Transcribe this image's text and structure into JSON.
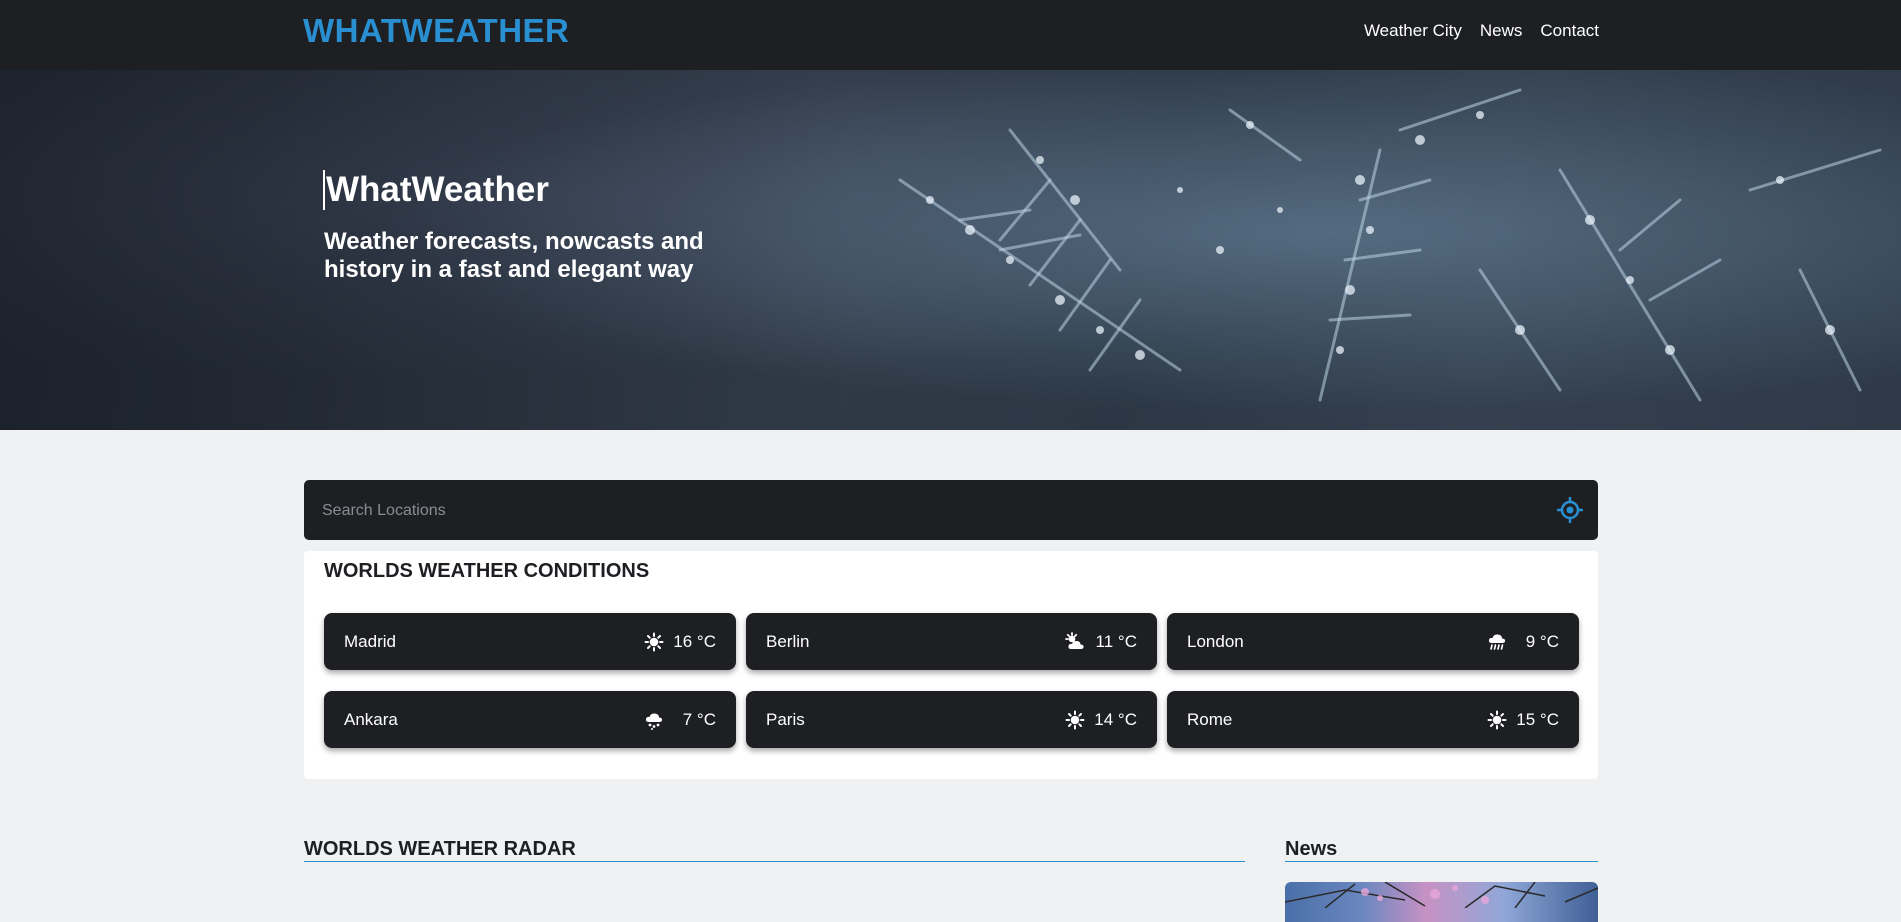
{
  "header": {
    "brand": "WHATWEATHER",
    "nav": [
      "Weather City",
      "News",
      "Contact"
    ]
  },
  "hero": {
    "title": "WhatWeather",
    "subtitle": "Weather forecasts, nowcasts and history in a fast and elegant way"
  },
  "search": {
    "placeholder": "Search Locations",
    "value": ""
  },
  "conditions": {
    "title": "WORLDS WEATHER CONDITIONS",
    "cities": [
      {
        "name": "Madrid",
        "icon": "sun-icon",
        "temp": "16 °C"
      },
      {
        "name": "Berlin",
        "icon": "partly-cloudy-icon",
        "temp": "11 °C"
      },
      {
        "name": "London",
        "icon": "rain-icon",
        "temp": "9 °C"
      },
      {
        "name": "Ankara",
        "icon": "hail-icon",
        "temp": "7 °C"
      },
      {
        "name": "Paris",
        "icon": "sun-icon",
        "temp": "14 °C"
      },
      {
        "name": "Rome",
        "icon": "sun-icon",
        "temp": "15 °C"
      }
    ]
  },
  "radar": {
    "title": "WORLDS WEATHER RADAR"
  },
  "news": {
    "title": "News"
  },
  "colors": {
    "accent": "#2a8fd0",
    "dark": "#1d1f23",
    "background": "#eff1f3"
  }
}
